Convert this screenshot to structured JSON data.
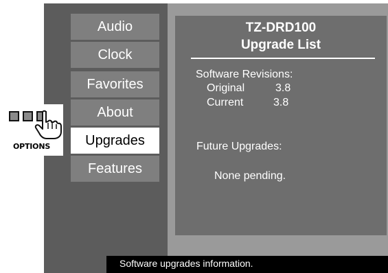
{
  "menu": {
    "items": [
      {
        "label": "Audio",
        "selected": false
      },
      {
        "label": "Clock",
        "selected": false
      },
      {
        "label": "Favorites",
        "selected": false
      },
      {
        "label": "About",
        "selected": false
      },
      {
        "label": "Upgrades",
        "selected": true
      },
      {
        "label": "Features",
        "selected": false
      }
    ]
  },
  "panel": {
    "model": "TZ-DRD100",
    "heading": "Upgrade List",
    "revisions_label": "Software Revisions:",
    "original_label": "Original",
    "original_value": "3.8",
    "current_label": "Current",
    "current_value": "3.8",
    "future_label": "Future Upgrades:",
    "future_status": "None pending."
  },
  "status": {
    "text": "Software upgrades information."
  },
  "options_button": {
    "label": "OPTIONS",
    "icon": "hand-pointer-icon"
  },
  "colors": {
    "screen_bg": "#5a5a5a",
    "menu_item_bg": "#7f7f7f",
    "menu_item_selected_bg": "#ffffff",
    "content_bg": "#6e6e6e",
    "status_bar_bg": "#000000"
  }
}
